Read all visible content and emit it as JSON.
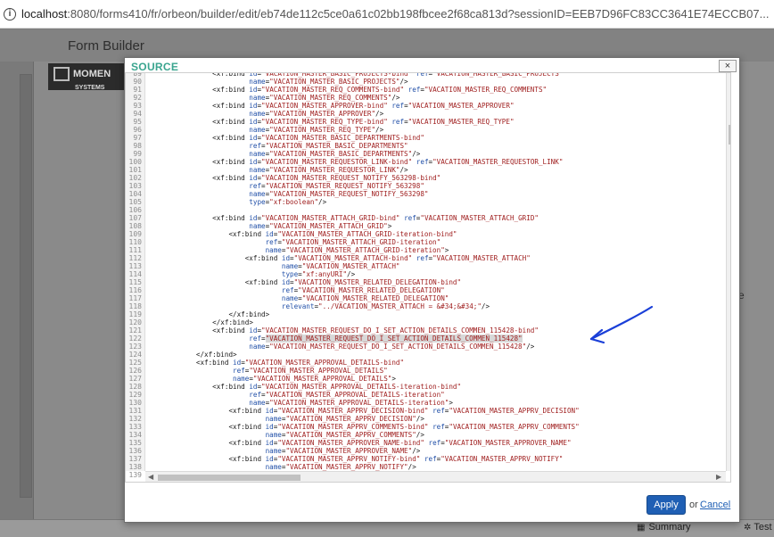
{
  "browser": {
    "info_icon": "info-icon",
    "url_host": "localhost",
    "url_rest": ":8080/forms410/fr/orbeon/builder/edit/eb74de112c5ce0a61c02bb198fbcee2f68ca813d?sessionID=EEB7D96FC83CC3641E74ECCB07..."
  },
  "app": {
    "title": "Form Builder",
    "logo_text": "MOMEN",
    "logo_subtext": "SYSTEMS",
    "right_edge_text": "e"
  },
  "dialog": {
    "title": "SOURCE",
    "close_label": "×",
    "apply_label": "Apply",
    "or_label": "or",
    "cancel_label": "Cancel"
  },
  "editor": {
    "lines": [
      {
        "n": "89",
        "t": "                <xf:bind id=\"VACATION_MASTER_BASIC_PROJECTS-bind\" ref=\"VACATION_MASTER_BASIC_PROJECTS\""
      },
      {
        "n": "90",
        "t": "                         name=\"VACATION_MASTER_BASIC_PROJECTS\"/>"
      },
      {
        "n": "91",
        "t": "                <xf:bind id=\"VACATION_MASTER_REQ_COMMENTS-bind\" ref=\"VACATION_MASTER_REQ_COMMENTS\""
      },
      {
        "n": "92",
        "t": "                         name=\"VACATION_MASTER_REQ_COMMENTS\"/>"
      },
      {
        "n": "93",
        "t": "                <xf:bind id=\"VACATION_MASTER_APPROVER-bind\" ref=\"VACATION_MASTER_APPROVER\""
      },
      {
        "n": "94",
        "t": "                         name=\"VACATION_MASTER_APPROVER\"/>"
      },
      {
        "n": "95",
        "t": "                <xf:bind id=\"VACATION_MASTER_REQ_TYPE-bind\" ref=\"VACATION_MASTER_REQ_TYPE\""
      },
      {
        "n": "96",
        "t": "                         name=\"VACATION_MASTER_REQ_TYPE\"/>"
      },
      {
        "n": "97",
        "t": "                <xf:bind id=\"VACATION_MASTER_BASIC_DEPARTMENTS-bind\""
      },
      {
        "n": "98",
        "t": "                         ref=\"VACATION_MASTER_BASIC_DEPARTMENTS\""
      },
      {
        "n": "99",
        "t": "                         name=\"VACATION_MASTER_BASIC_DEPARTMENTS\"/>"
      },
      {
        "n": "100",
        "t": "                <xf:bind id=\"VACATION_MASTER_REQUESTOR_LINK-bind\" ref=\"VACATION_MASTER_REQUESTOR_LINK\""
      },
      {
        "n": "101",
        "t": "                         name=\"VACATION_MASTER_REQUESTOR_LINK\"/>"
      },
      {
        "n": "102",
        "t": "                <xf:bind id=\"VACATION_MASTER_REQUEST_NOTIFY_563298-bind\""
      },
      {
        "n": "103",
        "t": "                         ref=\"VACATION_MASTER_REQUEST_NOTIFY_563298\""
      },
      {
        "n": "104",
        "t": "                         name=\"VACATION_MASTER_REQUEST_NOTIFY_563298\""
      },
      {
        "n": "105",
        "t": "                         type=\"xf:boolean\"/>"
      },
      {
        "n": "106",
        "t": ""
      },
      {
        "n": "107",
        "t": "                <xf:bind id=\"VACATION_MASTER_ATTACH_GRID-bind\" ref=\"VACATION_MASTER_ATTACH_GRID\""
      },
      {
        "n": "108",
        "t": "                         name=\"VACATION_MASTER_ATTACH_GRID\">"
      },
      {
        "n": "109",
        "t": "                    <xf:bind id=\"VACATION_MASTER_ATTACH_GRID-iteration-bind\""
      },
      {
        "n": "110",
        "t": "                             ref=\"VACATION_MASTER_ATTACH_GRID-iteration\""
      },
      {
        "n": "111",
        "t": "                             name=\"VACATION_MASTER_ATTACH_GRID-iteration\">"
      },
      {
        "n": "112",
        "t": "                        <xf:bind id=\"VACATION_MASTER_ATTACH-bind\" ref=\"VACATION_MASTER_ATTACH\""
      },
      {
        "n": "113",
        "t": "                                 name=\"VACATION_MASTER_ATTACH\""
      },
      {
        "n": "114",
        "t": "                                 type=\"xf:anyURI\"/>"
      },
      {
        "n": "115",
        "t": "                        <xf:bind id=\"VACATION_MASTER_RELATED_DELEGATION-bind\""
      },
      {
        "n": "116",
        "t": "                                 ref=\"VACATION_MASTER_RELATED_DELEGATION\""
      },
      {
        "n": "117",
        "t": "                                 name=\"VACATION_MASTER_RELATED_DELEGATION\""
      },
      {
        "n": "118",
        "t": "                                 relevant=\"../VACATION_MASTER_ATTACH = &#34;&#34;\"/>"
      },
      {
        "n": "119",
        "t": "                    </xf:bind>"
      },
      {
        "n": "120",
        "t": "                </xf:bind>"
      },
      {
        "n": "121",
        "t": "                <xf:bind id=\"VACATION_MASTER_REQUEST_DO_I_SET_ACTION_DETAILS_COMMEN_115428-bind\""
      },
      {
        "n": "122",
        "t": "                         ref=\"VACATION_MASTER_REQUEST_DO_I_SET_ACTION_DETAILS_COMMEN_115428\"",
        "hl": true
      },
      {
        "n": "123",
        "t": "                         name=\"VACATION_MASTER_REQUEST_DO_I_SET_ACTION_DETAILS_COMMEN_115428\"/>"
      },
      {
        "n": "124",
        "t": "            </xf:bind>"
      },
      {
        "n": "125",
        "t": "            <xf:bind id=\"VACATION_MASTER_APPROVAL_DETAILS-bind\""
      },
      {
        "n": "126",
        "t": "                     ref=\"VACATION_MASTER_APPROVAL_DETAILS\""
      },
      {
        "n": "127",
        "t": "                     name=\"VACATION_MASTER_APPROVAL_DETAILS\">"
      },
      {
        "n": "128",
        "t": "                <xf:bind id=\"VACATION_MASTER_APPROVAL_DETAILS-iteration-bind\""
      },
      {
        "n": "129",
        "t": "                         ref=\"VACATION_MASTER_APPROVAL_DETAILS-iteration\""
      },
      {
        "n": "130",
        "t": "                         name=\"VACATION_MASTER_APPROVAL_DETAILS-iteration\">"
      },
      {
        "n": "131",
        "t": "                    <xf:bind id=\"VACATION_MASTER_APPRV_DECISION-bind\" ref=\"VACATION_MASTER_APPRV_DECISION\""
      },
      {
        "n": "132",
        "t": "                             name=\"VACATION_MASTER_APPRV_DECISION\"/>"
      },
      {
        "n": "133",
        "t": "                    <xf:bind id=\"VACATION_MASTER_APPRV_COMMENTS-bind\" ref=\"VACATION_MASTER_APPRV_COMMENTS\""
      },
      {
        "n": "134",
        "t": "                             name=\"VACATION_MASTER_APPRV_COMMENTS\"/>"
      },
      {
        "n": "135",
        "t": "                    <xf:bind id=\"VACATION_MASTER_APPROVER_NAME-bind\" ref=\"VACATION_MASTER_APPROVER_NAME\""
      },
      {
        "n": "136",
        "t": "                             name=\"VACATION_MASTER_APPROVER_NAME\"/>"
      },
      {
        "n": "137",
        "t": "                    <xf:bind id=\"VACATION_MASTER_APPRV_NOTIFY-bind\" ref=\"VACATION_MASTER_APPRV_NOTIFY\""
      },
      {
        "n": "138",
        "t": "                             name=\"VACATION_MASTER_APPRV_NOTIFY\"/>"
      },
      {
        "n": "139",
        "t": ""
      }
    ]
  },
  "footer": {
    "summary_label": "Summary",
    "test_label": "Test",
    "summary_icon": "grid-icon",
    "test_icon": "gear-icon"
  },
  "colors": {
    "dialog_title": "#3aa58f",
    "apply_button": "#1f5fb4",
    "annotation_arrow": "#1a3fd8"
  }
}
